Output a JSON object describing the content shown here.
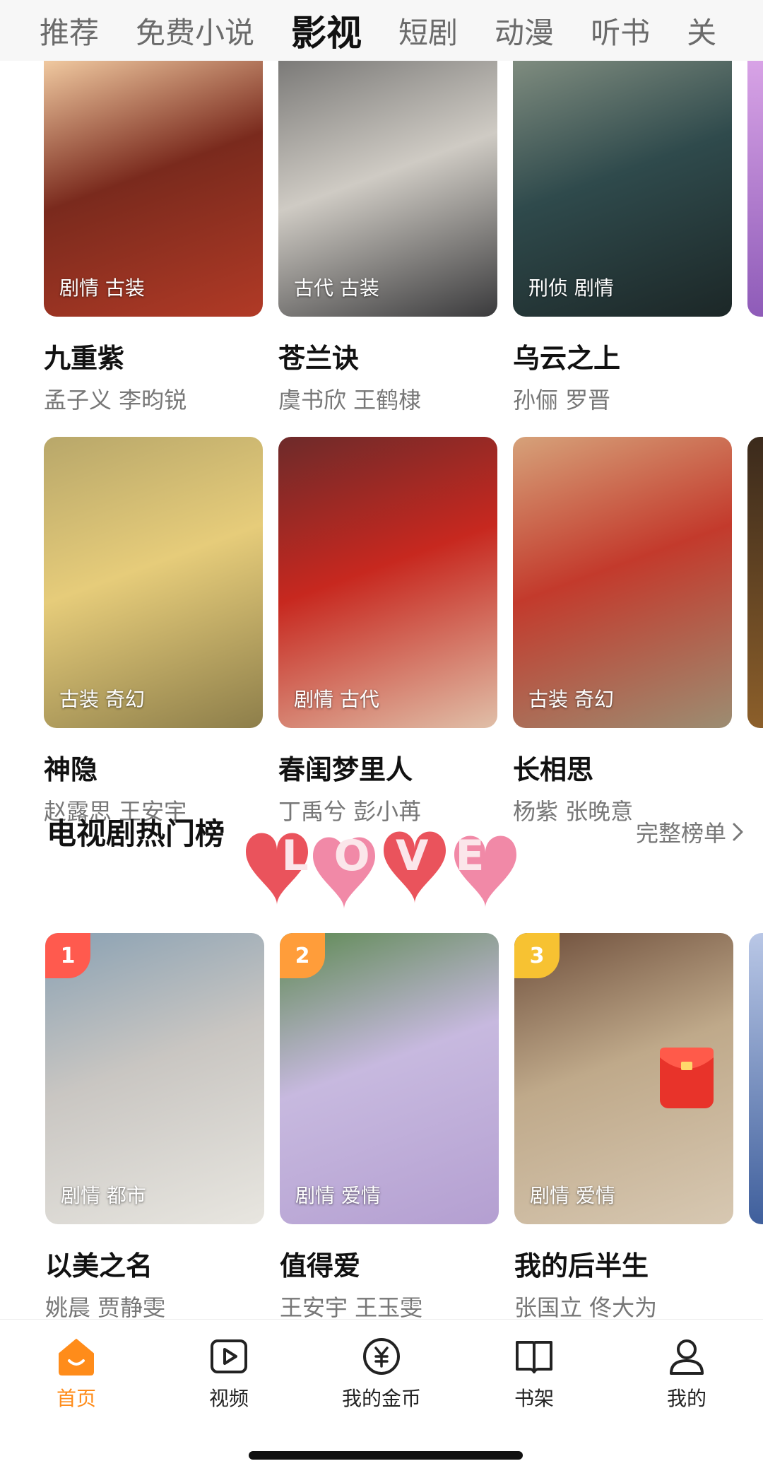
{
  "top_tabs": [
    {
      "label": "推荐",
      "active": false
    },
    {
      "label": "免费小说",
      "active": false
    },
    {
      "label": "影视",
      "active": true
    },
    {
      "label": "短剧",
      "active": false
    },
    {
      "label": "动漫",
      "active": false
    },
    {
      "label": "听书",
      "active": false
    },
    {
      "label": "关",
      "active": false
    }
  ],
  "grid": [
    {
      "title": "九重紫",
      "cast": "孟子义 李昀锐",
      "tags": "剧情 古装",
      "colors": [
        "#7a2a1d",
        "#f0c9a0",
        "#b13a26"
      ]
    },
    {
      "title": "苍兰诀",
      "cast": "虞书欣 王鹤棣",
      "tags": "古代 古装",
      "colors": [
        "#cfcbc4",
        "#7b7a78",
        "#3a3a3c"
      ]
    },
    {
      "title": "乌云之上",
      "cast": "孙俪 罗晋",
      "tags": "刑侦 剧情",
      "colors": [
        "#2f4a4c",
        "#7f8c7f",
        "#1c2727"
      ]
    },
    {
      "title": "神隐",
      "cast": "赵露思 王安宇",
      "tags": "古装 奇幻",
      "colors": [
        "#e6cc7a",
        "#b8a76a",
        "#8d7e4a"
      ]
    },
    {
      "title": "春闺梦里人",
      "cast": "丁禹兮 彭小苒",
      "tags": "剧情 古代",
      "colors": [
        "#c7281f",
        "#6d2a2a",
        "#e0bfa8"
      ]
    },
    {
      "title": "长相思",
      "cast": "杨紫 张晚意",
      "tags": "古装 奇幻",
      "colors": [
        "#c33a2c",
        "#d6a27a",
        "#9c8d72"
      ]
    }
  ],
  "section": {
    "title": "电视剧热门榜",
    "more": "完整榜单"
  },
  "ranking": [
    {
      "rank": "1",
      "title": "以美之名",
      "cast": "姚晨 贾静雯",
      "tags": "剧情 都市",
      "badge_color": "#ff5a4e",
      "colors": [
        "#c9c6c2",
        "#8aa1b3",
        "#e8e6e0"
      ]
    },
    {
      "rank": "2",
      "title": "值得爱",
      "cast": "王安宇 王玉雯",
      "tags": "剧情 爱情",
      "badge_color": "#ff9d3a",
      "colors": [
        "#c7b9df",
        "#5e8a53",
        "#b49fd1"
      ]
    },
    {
      "rank": "3",
      "title": "我的后半生",
      "cast": "张国立 佟大为",
      "tags": "剧情 爱情",
      "badge_color": "#f7c232",
      "colors": [
        "#bfa98a",
        "#6e4e3b",
        "#d7c8b2"
      ]
    }
  ],
  "sticker": {
    "text": "LOVE"
  },
  "bottom_nav": [
    {
      "label": "首页",
      "icon": "home-icon",
      "active": true
    },
    {
      "label": "视频",
      "icon": "video-icon",
      "active": false
    },
    {
      "label": "我的金币",
      "icon": "coin-icon",
      "active": false
    },
    {
      "label": "书架",
      "icon": "bookshelf-icon",
      "active": false
    },
    {
      "label": "我的",
      "icon": "profile-icon",
      "active": false
    }
  ],
  "accent_color": "#ff8c1a"
}
